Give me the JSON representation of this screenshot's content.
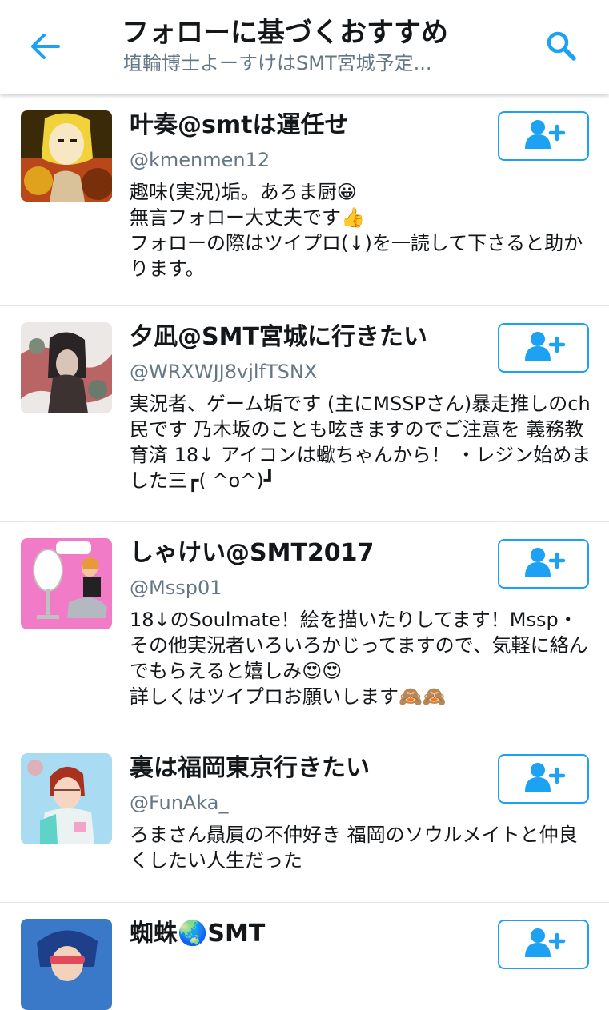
{
  "header": {
    "title": "フォローに基づくおすすめ",
    "subtitle": "埴輪博士よーすけはSMT宮城予定...",
    "back_icon": "arrow-left-icon",
    "search_icon": "search-icon"
  },
  "colors": {
    "accent": "#1da1f2",
    "text_primary": "#14171a",
    "text_secondary": "#657786",
    "divider": "#e1e8ed"
  },
  "users": [
    {
      "name": "叶奏@smtは運任せ",
      "handle": "@kmenmen12",
      "bio": "趣味(実況)垢。あろま厨😀\n無言フォロー大丈夫です👍\nフォローの際はツイプロ(↓)を一読して下さると助かります。",
      "follow_icon": "follow-user-icon"
    },
    {
      "name": "夕凪@SMT宮城に行きたい",
      "handle": "@WRXWJJ8vjlfTSNX",
      "bio": "実況者、ゲーム垢です (主にMSSPさん)暴走推しのch民です 乃木坂のことも呟きますのでご注意を 義務教育済 18↓ アイコンは蠍ちゃんから！ ・レジン始めました三┏( ^o^)┛",
      "follow_icon": "follow-user-icon"
    },
    {
      "name": "しゃけい@SMT2017",
      "handle": "@Mssp01",
      "bio": "18↓のSoulmate！絵を描いたりしてます！Mssp・その他実況者いろいろかじってますので、気軽に絡んでもらえると嬉しみ😍😍\n詳しくはツイプロお願いします🙈🙈",
      "follow_icon": "follow-user-icon"
    },
    {
      "name": "裏は福岡東京行きたい",
      "handle": "@FunAka_",
      "bio": "ろまさん贔屓の不仲好き 福岡のソウルメイトと仲良くしたい人生だった",
      "follow_icon": "follow-user-icon"
    },
    {
      "name": "蜘蛛🌏SMT",
      "handle": "",
      "bio": "",
      "follow_icon": "follow-user-icon"
    }
  ]
}
